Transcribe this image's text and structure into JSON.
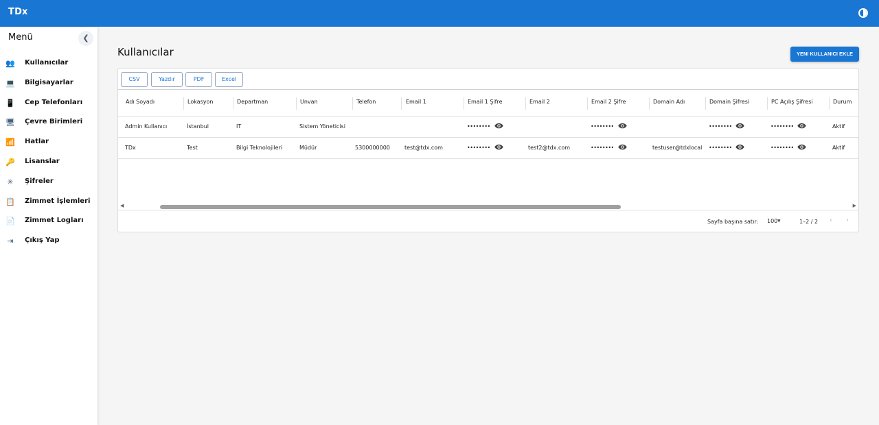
{
  "app": {
    "title": "TDx",
    "theme_icon": "brightness-icon"
  },
  "sidebar": {
    "title": "Menü",
    "items": [
      {
        "label": "Kullanıcılar",
        "icon": "people-icon",
        "glyph": "👥"
      },
      {
        "label": "Bilgisayarlar",
        "icon": "laptop-icon",
        "glyph": "💻"
      },
      {
        "label": "Cep Telefonları",
        "icon": "phone-icon",
        "glyph": "📱"
      },
      {
        "label": "Çevre Birimleri",
        "icon": "devices-icon",
        "glyph": "🖥"
      },
      {
        "label": "Hatlar",
        "icon": "router-icon",
        "glyph": "📶"
      },
      {
        "label": "Lisanslar",
        "icon": "key-icon",
        "glyph": "🔑"
      },
      {
        "label": "Şifreler",
        "icon": "password-icon",
        "glyph": "✳"
      },
      {
        "label": "Zimmet İşlemleri",
        "icon": "assignment-ind-icon",
        "glyph": "📋"
      },
      {
        "label": "Zimmet Logları",
        "icon": "assignment-icon",
        "glyph": "📄"
      },
      {
        "label": "Çıkış Yap",
        "icon": "logout-icon",
        "glyph": "⇥"
      }
    ]
  },
  "page": {
    "title": "Kullanıcılar",
    "add_button": "YENI KULLANICI EKLE"
  },
  "toolbar": {
    "csv": "CSV",
    "print": "Yazdır",
    "pdf": "PDF",
    "excel": "Excel"
  },
  "table": {
    "columns": [
      "Adı Soyadı",
      "Lokasyon",
      "Departman",
      "Unvan",
      "Telefon",
      "Email 1",
      "Email 1 Şifre",
      "Email 2",
      "Email 2 Şifre",
      "Domain Adı",
      "Domain Şifresi",
      "PC Açılış Şifresi",
      "Durum"
    ],
    "mask": "••••••••",
    "rows": [
      {
        "name": "Admin Kullanıcı",
        "location": "İstanbul",
        "department": "IT",
        "title": "Sistem Yöneticisi",
        "phone": "",
        "email1": "",
        "email2": "",
        "domain": "",
        "status": "Aktif"
      },
      {
        "name": "TDx",
        "location": "Test",
        "department": "Bilgi Teknolojileri",
        "title": "Müdür",
        "phone": "5300000000",
        "email1": "test@tdx.com",
        "email2": "test2@tdx.com",
        "domain": "testuser@tdxlocal",
        "status": "Aktif"
      }
    ]
  },
  "pagination": {
    "rows_per_page_label": "Sayfa başına satır:",
    "rows_per_page": "100",
    "range": "1–2 / 2"
  }
}
